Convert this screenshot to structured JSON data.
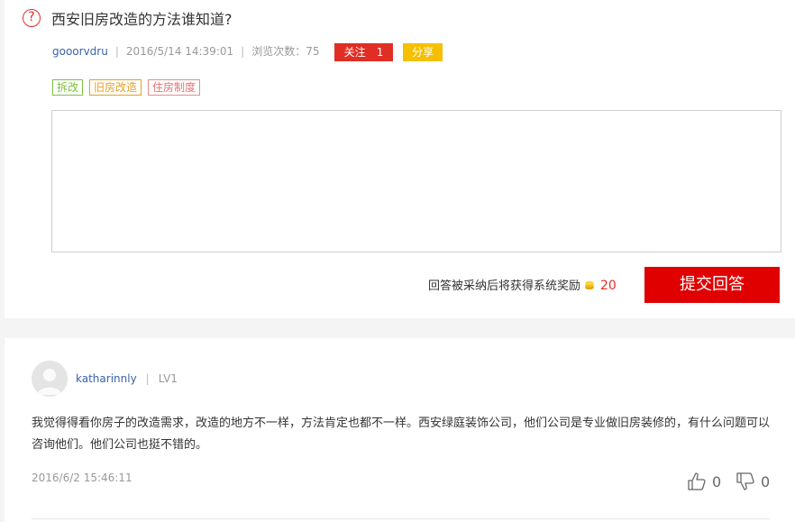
{
  "question": {
    "title": "西安旧房改造的方法谁知道?",
    "user": "gooorvdru",
    "time": "2016/5/14 14:39:01",
    "views_label": "浏览次数：75",
    "follow_label": "关注",
    "follow_count": "1",
    "share_label": "分享",
    "tags": [
      "拆改",
      "旧房改造",
      "住房制度"
    ],
    "reward_text": "回答被采纳后将获得系统奖励",
    "reward_points": "20",
    "submit_label": "提交回答"
  },
  "answer": {
    "user": "katharinnly",
    "level": "LV1",
    "text": "我觉得得看你房子的改造需求，改造的地方不一样，方法肯定也都不一样。西安绿庭装饰公司，他们公司是专业做旧房装修的，有什么问题可以咨询他们。他们公司也挺不错的。",
    "time": "2016/6/2 15:46:11",
    "up_count": "0",
    "down_count": "0"
  },
  "colors": {
    "accent": "#e02e24",
    "share": "#f5c000",
    "link": "#3a63a8"
  }
}
